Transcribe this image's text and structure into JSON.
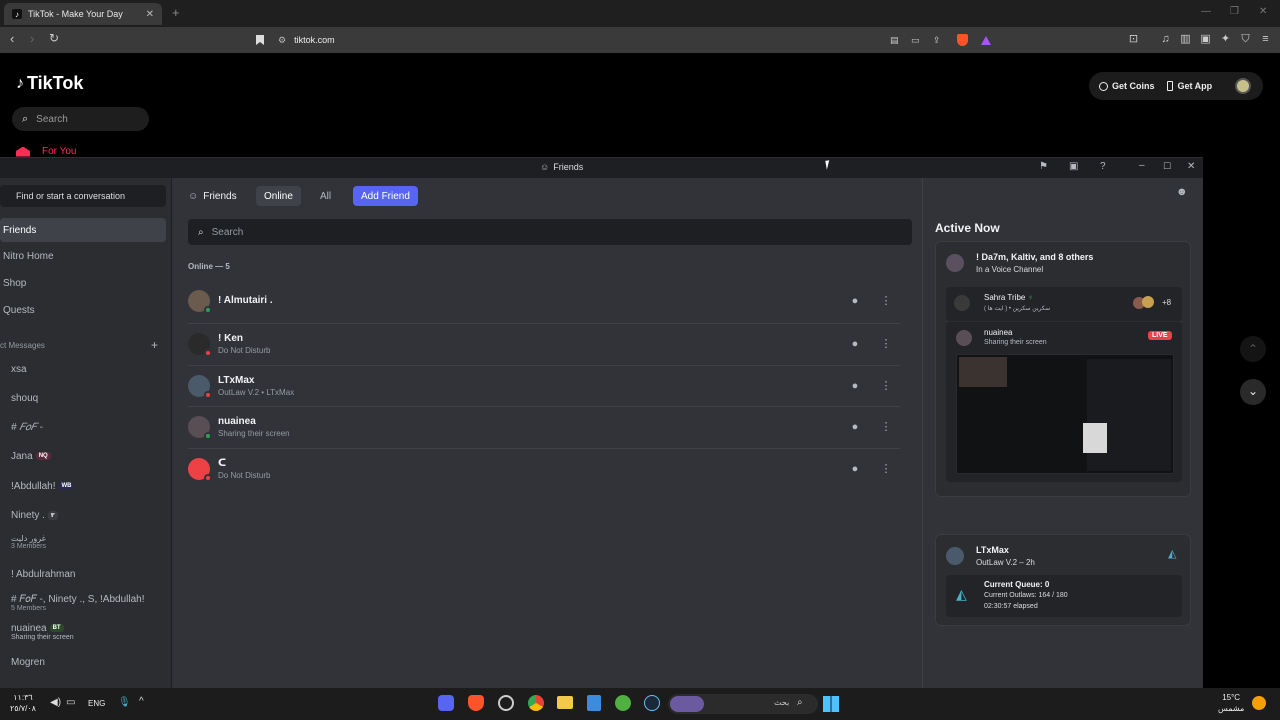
{
  "browser": {
    "tab_title": "TikTok - Make Your Day",
    "url": "tiktok.com"
  },
  "tiktok": {
    "logo": "TikTok",
    "search_placeholder": "Search",
    "for_you": "For You",
    "get_coins": "Get Coins",
    "get_app": "Get App"
  },
  "discord": {
    "window_title": "Friends",
    "find_conversation": "Find or start a conversation",
    "nav": [
      "Friends",
      "Nitro Home",
      "Shop",
      "Quests"
    ],
    "dm_header": "ct Messages",
    "dms": [
      {
        "name": "xsa",
        "sub": ""
      },
      {
        "name": "shouq",
        "sub": ""
      },
      {
        "name": "# 𝐹𝑜𝐹 -",
        "sub": ""
      },
      {
        "name": "Jana",
        "badge": "NQ",
        "sub": ""
      },
      {
        "name": "!Abdullah!",
        "badge": "WB",
        "sub": ""
      },
      {
        "name": "Ninety .",
        "badge": "٣",
        "sub": ""
      },
      {
        "name": "غرور دليت",
        "sub": "3 Members"
      },
      {
        "name": "! Abdulrahman",
        "sub": ""
      },
      {
        "name": "# 𝐹𝑜𝐹 -, Ninety ., S, !Abdullah!",
        "sub": "5 Members"
      },
      {
        "name": "nuainea",
        "badge": "BT",
        "sub": "Sharing their screen"
      },
      {
        "name": "Mogren",
        "sub": ""
      }
    ],
    "tabs": {
      "friends": "Friends",
      "online": "Online",
      "all": "All",
      "add_friend": "Add Friend"
    },
    "search_placeholder": "Search",
    "online_count": "Online — 5",
    "friends": [
      {
        "name": "! Almutairi .",
        "status": "",
        "status_color": "#23a55a",
        "avatar_color": "#6b5a4e"
      },
      {
        "name": "! Ken",
        "status": "Do Not Disturb",
        "status_color": "#f23f43",
        "avatar_color": "#2a2a2a"
      },
      {
        "name": "LTxMax",
        "status": "OutLaw V.2 • LTxMax",
        "status_color": "#f23f43",
        "avatar_color": "#4a5a6a"
      },
      {
        "name": "nuainea",
        "status": "Sharing their screen",
        "status_color": "#23a55a",
        "avatar_color": "#5a4e55"
      },
      {
        "name": "ᑕ",
        "status": "Do Not Disturb",
        "status_color": "#f23f43",
        "avatar_color": "#ed4245"
      }
    ],
    "active_now": {
      "title": "Active Now",
      "voice": {
        "title": "! Da7m, Kaltiv, and 8 others",
        "sub": "In a Voice Channel",
        "server_name": "Sahra Tribe",
        "server_sub": "سكرين سكرين • ( ايت ها )",
        "extra_count": "+8",
        "streamer": "nuainea",
        "streamer_sub": "Sharing their screen",
        "live": "LIVE"
      },
      "game": {
        "name": "LTxMax",
        "sub": "OutLaw V.2 – 2h",
        "queue": "Current Queue: 0",
        "outlaws": "Current Outlaws: 164 / 180",
        "elapsed": "02:30:57 elapsed"
      }
    }
  },
  "taskbar": {
    "time": "١١:٣٦",
    "date": "٢٥/٧/٠٨",
    "lang": "ENG",
    "search": "بحث",
    "weather_temp": "15°C",
    "weather_desc": "مشمس"
  },
  "colors": {
    "blurple": "#5865f2",
    "live_red": "#ed4245",
    "online_green": "#23a55a",
    "dnd_red": "#f23f43",
    "tiktok_red": "#fe2c55"
  }
}
